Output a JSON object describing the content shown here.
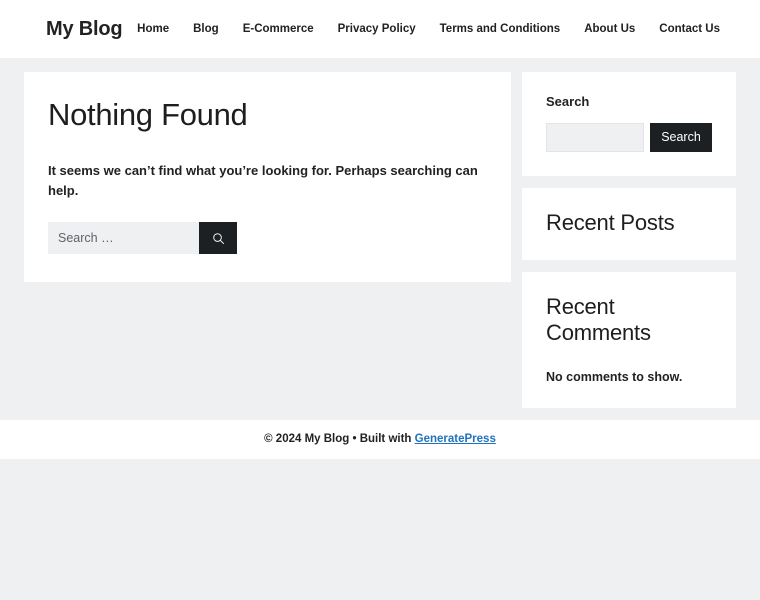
{
  "header": {
    "site_title": "My Blog",
    "nav": [
      {
        "label": "Home"
      },
      {
        "label": "Blog"
      },
      {
        "label": "E-Commerce"
      },
      {
        "label": "Privacy Policy"
      },
      {
        "label": "Terms and Conditions"
      },
      {
        "label": "About Us"
      },
      {
        "label": "Contact Us"
      }
    ]
  },
  "main": {
    "title": "Nothing Found",
    "message": "It seems we can’t find what you’re looking for. Perhaps searching can help.",
    "search": {
      "value": "",
      "placeholder": "Search …",
      "submit_icon": "search-icon"
    }
  },
  "sidebar": {
    "widgets": [
      {
        "type": "search",
        "title": "Search",
        "input_value": "",
        "input_placeholder": "",
        "button_label": "Search"
      },
      {
        "type": "recent-posts",
        "title": "Recent Posts",
        "items": []
      },
      {
        "type": "recent-comments",
        "title": "Recent Comments",
        "empty_text": "No comments to show."
      }
    ]
  },
  "footer": {
    "copyright": "© 2024 My Blog • Built with ",
    "link_label": "GeneratePress"
  },
  "colors": {
    "page_background": "#eef0f2",
    "surface": "#ffffff",
    "text": "#222222",
    "button_dark": "#1d2022",
    "link_blue": "#1e73be"
  }
}
